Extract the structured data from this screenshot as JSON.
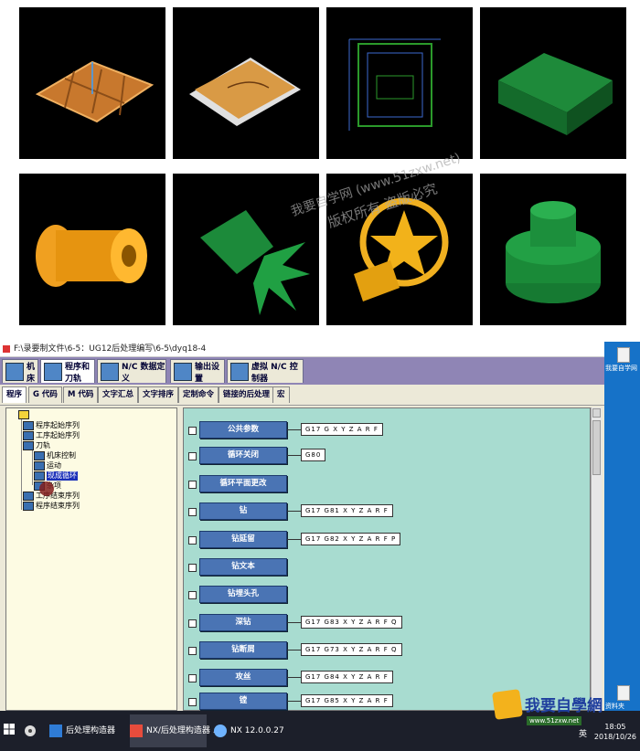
{
  "window": {
    "title": "F:\\录要制文件\\6-5：UG12后处理编写\\6-5\\dyq18-4"
  },
  "main_tabs": [
    {
      "label": "机床"
    },
    {
      "label": "程序和刀轨"
    },
    {
      "label": "N/C 数据定义"
    },
    {
      "label": "输出设置"
    },
    {
      "label": "虚拟 N/C 控制器"
    }
  ],
  "sub_tabs": [
    {
      "label": "程序"
    },
    {
      "label": "G 代码"
    },
    {
      "label": "M 代码"
    },
    {
      "label": "文字汇总"
    },
    {
      "label": "文字排序"
    },
    {
      "label": "定制命令"
    },
    {
      "label": "链接的后处理"
    },
    {
      "label": "宏"
    }
  ],
  "tree": [
    {
      "label": "程序起始序列"
    },
    {
      "label": "工序起始序列"
    },
    {
      "label": "刀轨"
    },
    {
      "label": "机床控制"
    },
    {
      "label": "运动"
    },
    {
      "label": "现成循环"
    },
    {
      "label": "杂项"
    },
    {
      "label": "工序结束序列"
    },
    {
      "label": "程序结束序列"
    }
  ],
  "commands": [
    {
      "label": "公共参数",
      "format": "G17 G X Y Z A R F"
    },
    {
      "label": "循环关闭",
      "format": "G80"
    },
    {
      "label": "循环平面更改",
      "format": ""
    },
    {
      "label": "钻",
      "format": "G17 G81 X Y Z A R F"
    },
    {
      "label": "钻延留",
      "format": "G17 G82 X Y Z A R F P"
    },
    {
      "label": "钻文本",
      "format": ""
    },
    {
      "label": "钻埋头孔",
      "format": ""
    },
    {
      "label": "深钻",
      "format": "G17 G83 X Y Z A R F Q"
    },
    {
      "label": "钻断屑",
      "format": "G17 G73 X Y Z A R F Q"
    },
    {
      "label": "攻丝",
      "format": "G17 G84 X Y Z A R F"
    },
    {
      "label": "镗",
      "format": "G17 G85 X Y Z A R F"
    }
  ],
  "watermark": {
    "line1": "我要自学网 (www.51zxw.net)",
    "line2": "版权所有 盗版必究"
  },
  "desktop_icons": [
    {
      "label": "我要自学网"
    },
    {
      "label": "资料夹"
    }
  ],
  "taskbar": {
    "items": [
      {
        "label": "后处理构造器"
      },
      {
        "label": "NX/后处理构造器 ..."
      },
      {
        "label": "NX 12.0.0.27"
      }
    ],
    "clock_time": "18:05",
    "clock_date": "2018/10/26",
    "ime": "英"
  },
  "logo": {
    "text": "我要自學網",
    "url": "www.51zxw.net"
  },
  "colors": {
    "cmd_pane_bg": "#a8dcd0",
    "tree_pane_bg": "#fdfbe3",
    "tab_strip": "#8f85b5",
    "command_button": "#4a74b4",
    "taskbar": "#1c1f2a",
    "desktop": "#1672c8"
  }
}
